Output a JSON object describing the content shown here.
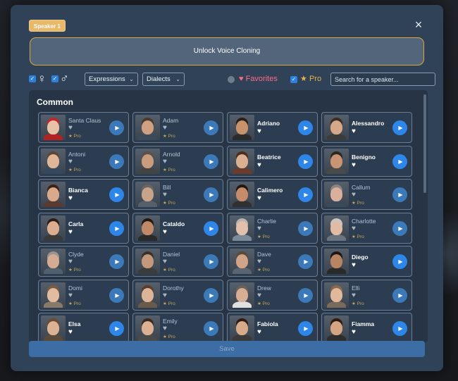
{
  "speaker_tag": "Speaker 1",
  "close_icon": "×",
  "unlock_label": "Unlock Voice Cloning",
  "filters": {
    "female_symbol": "♀",
    "male_symbol": "♂",
    "expressions_label": "Expressions",
    "dialects_label": "Dialects",
    "favorites_label": "Favorites",
    "pro_label": "Pro",
    "search_placeholder": "Search for a speaker..."
  },
  "section_title": "Common",
  "pro_badge": "Pro",
  "speakers": [
    {
      "name": "Santa Claus",
      "tier": "pro",
      "skin": "#e8c2a8",
      "hair": "#c2272d",
      "shirt": "#b22222"
    },
    {
      "name": "Adam",
      "tier": "pro",
      "skin": "#d0a082",
      "hair": "#4a3a2e",
      "shirt": "#3c4a5c"
    },
    {
      "name": "Adriano",
      "tier": "free",
      "skin": "#c8936c",
      "hair": "#2a1f18",
      "shirt": "#2c2c2c"
    },
    {
      "name": "Alessandro",
      "tier": "free",
      "skin": "#d6a88a",
      "hair": "#3a2c22",
      "shirt": "#3b3b3b"
    },
    {
      "name": "Antoni",
      "tier": "pro",
      "skin": "#e0b699",
      "hair": "#5a4636",
      "shirt": "#34495e"
    },
    {
      "name": "Arnold",
      "tier": "pro",
      "skin": "#c99c7e",
      "hair": "#5c5048",
      "shirt": "#444"
    },
    {
      "name": "Beatrice",
      "tier": "free",
      "skin": "#dab090",
      "hair": "#4c2c1c",
      "shirt": "#6b3b2b"
    },
    {
      "name": "Benigno",
      "tier": "free",
      "skin": "#c89474",
      "hair": "#2e2620",
      "shirt": "#4a4a4a"
    },
    {
      "name": "Bianca",
      "tier": "free",
      "skin": "#d9a98c",
      "hair": "#3c2216",
      "shirt": "#5a3a30"
    },
    {
      "name": "Bill",
      "tier": "pro",
      "skin": "#c8a38c",
      "hair": "#6c6660",
      "shirt": "#56606a"
    },
    {
      "name": "Calimero",
      "tier": "free",
      "skin": "#c48c6a",
      "hair": "#201812",
      "shirt": "#303030"
    },
    {
      "name": "Callum",
      "tier": "pro",
      "skin": "#d8b09c",
      "hair": "#8a8580",
      "shirt": "#3a4a5a"
    },
    {
      "name": "Carla",
      "tier": "free",
      "skin": "#dcae90",
      "hair": "#2c1c14",
      "shirt": "#3a3a3a"
    },
    {
      "name": "Cataldo",
      "tier": "free",
      "skin": "#c08a68",
      "hair": "#241a14",
      "shirt": "#2a2a2a"
    },
    {
      "name": "Charlie",
      "tier": "pro",
      "skin": "#e2c0ac",
      "hair": "#b8b4b0",
      "shirt": "#7a8a9a"
    },
    {
      "name": "Charlotte",
      "tier": "pro",
      "skin": "#e0bca4",
      "hair": "#c8c4c0",
      "shirt": "#6a7480"
    },
    {
      "name": "Clyde",
      "tier": "pro",
      "skin": "#d4ac94",
      "hair": "#9a948e",
      "shirt": "#50606c"
    },
    {
      "name": "Daniel",
      "tier": "pro",
      "skin": "#c4987c",
      "hair": "#3a302a",
      "shirt": "#3c3c3c"
    },
    {
      "name": "Dave",
      "tier": "pro",
      "skin": "#d0a486",
      "hair": "#5a4a3c",
      "shirt": "#5a6470"
    },
    {
      "name": "Diego",
      "tier": "free",
      "skin": "#b88462",
      "hair": "#1e1610",
      "shirt": "#2a2a2a"
    },
    {
      "name": "Domi",
      "tier": "pro",
      "skin": "#e2bca0",
      "hair": "#7a5a40",
      "shirt": "#8a7a6a"
    },
    {
      "name": "Dorothy",
      "tier": "pro",
      "skin": "#dcb498",
      "hair": "#5c3c2a",
      "shirt": "#6a5a4a"
    },
    {
      "name": "Drew",
      "tier": "pro",
      "skin": "#d6ae94",
      "hair": "#6a625a",
      "shirt": "#e0e0e0"
    },
    {
      "name": "Elli",
      "tier": "pro",
      "skin": "#e0b89c",
      "hair": "#8a6a4c",
      "shirt": "#7a6a5c"
    },
    {
      "name": "Elsa",
      "tier": "free",
      "skin": "#dcb294",
      "hair": "#6a4a30",
      "shirt": "#5a4a3a"
    },
    {
      "name": "Emily",
      "tier": "pro",
      "skin": "#dcb092",
      "hair": "#3c2a20",
      "shirt": "#4a4a4a"
    },
    {
      "name": "Fabiola",
      "tier": "free",
      "skin": "#d8aa8a",
      "hair": "#2c1c12",
      "shirt": "#3a3a3a"
    },
    {
      "name": "Fiamma",
      "tier": "free",
      "skin": "#d4a484",
      "hair": "#2a1a10",
      "shirt": "#2e2e2e"
    }
  ],
  "save_label": "Save"
}
